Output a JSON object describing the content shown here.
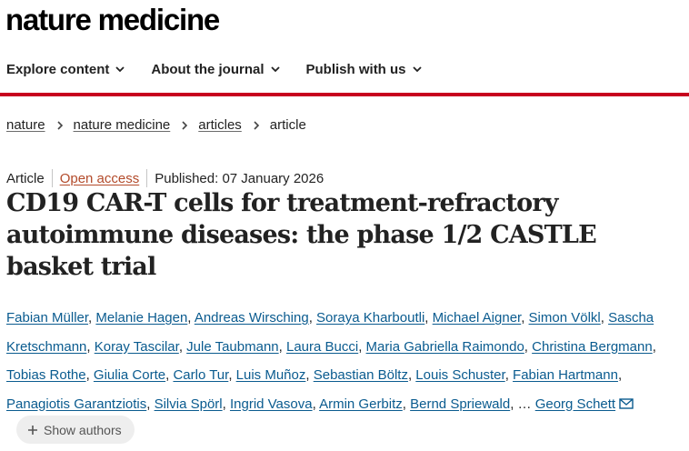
{
  "header": {
    "brand": "nature medicine",
    "nav": [
      {
        "label": "Explore content",
        "icon": "chevron-down-icon"
      },
      {
        "label": "About the journal",
        "icon": "chevron-down-icon"
      },
      {
        "label": "Publish with us",
        "icon": "chevron-down-icon"
      }
    ],
    "accent_color": "#c7001e"
  },
  "breadcrumb": [
    "nature",
    "nature medicine",
    "articles",
    "article"
  ],
  "meta": {
    "type": "Article",
    "access": "Open access",
    "published": "Published: 07 January 2026",
    "access_color": "#b34b2b"
  },
  "article": {
    "title": "CD19 CAR-T cells for treatment-refractory autoimmune diseases: the phase 1/2 CASTLE basket trial"
  },
  "authors": {
    "list": [
      "Fabian Müller",
      "Melanie Hagen",
      "Andreas Wirsching",
      "Soraya Kharboutli",
      "Michael Aigner",
      "Simon Völkl",
      "Sascha Kretschmann",
      "Koray Tascilar",
      "Jule Taubmann",
      "Laura Bucci",
      "Maria Gabriella Raimondo",
      "Christina Bergmann",
      "Tobias Rothe",
      "Giulia Corte",
      "Carlo Tur",
      "Luis Muñoz",
      "Sebastian Böltz",
      "Louis Schuster",
      "Fabian Hartmann",
      "Panagiotis Garantziotis",
      "Silvia Spörl",
      "Ingrid Vasova",
      "Armin Gerbitz",
      "Bernd Spriewald"
    ],
    "ellipsis": "…",
    "last": "Georg Schett",
    "show_label": "Show authors",
    "link_color": "#0a5b8f"
  }
}
